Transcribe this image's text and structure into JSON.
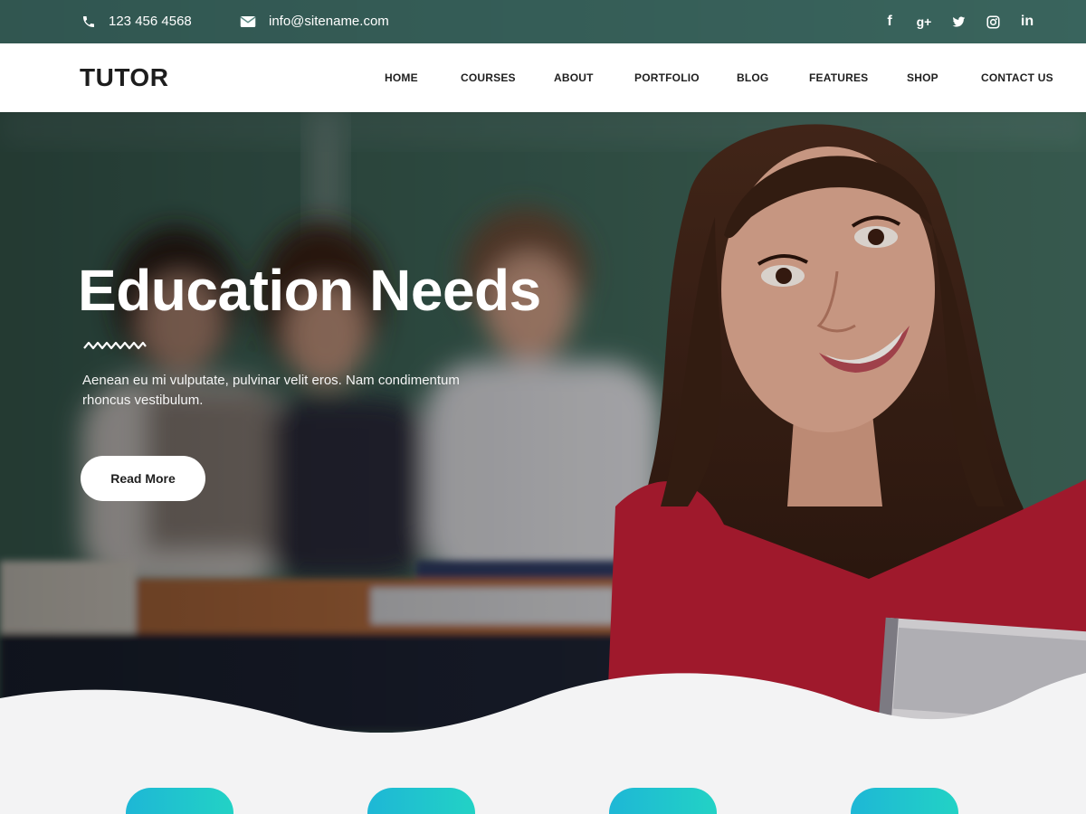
{
  "topbar": {
    "phone": "123 456 4568",
    "email": "info@sitename.com",
    "phone_icon": "phone-icon",
    "email_icon": "envelope-icon",
    "social": [
      {
        "icon": "facebook-icon",
        "glyph": "f"
      },
      {
        "icon": "google-plus-icon",
        "glyph": "g+"
      },
      {
        "icon": "twitter-icon",
        "glyph": "t"
      },
      {
        "icon": "instagram-icon",
        "glyph": "◎"
      },
      {
        "icon": "linkedin-icon",
        "glyph": "in"
      }
    ]
  },
  "navbar": {
    "logo": "TUTOR",
    "menu": [
      "HOME",
      "COURSES",
      "ABOUT",
      "PORTFOLIO",
      "BLOG",
      "FEATURES",
      "SHOP",
      "CONTACT US"
    ]
  },
  "hero": {
    "title": "Education Needs",
    "text": "Aenean eu mi vulputate, pulvinar velit  eros. Nam condimentum rhoncus vestibulum.",
    "button": "Read More"
  },
  "colors": {
    "accent_start": "#1eb7d6",
    "accent_end": "#22d2c5",
    "section_bg": "#f3f3f4"
  }
}
